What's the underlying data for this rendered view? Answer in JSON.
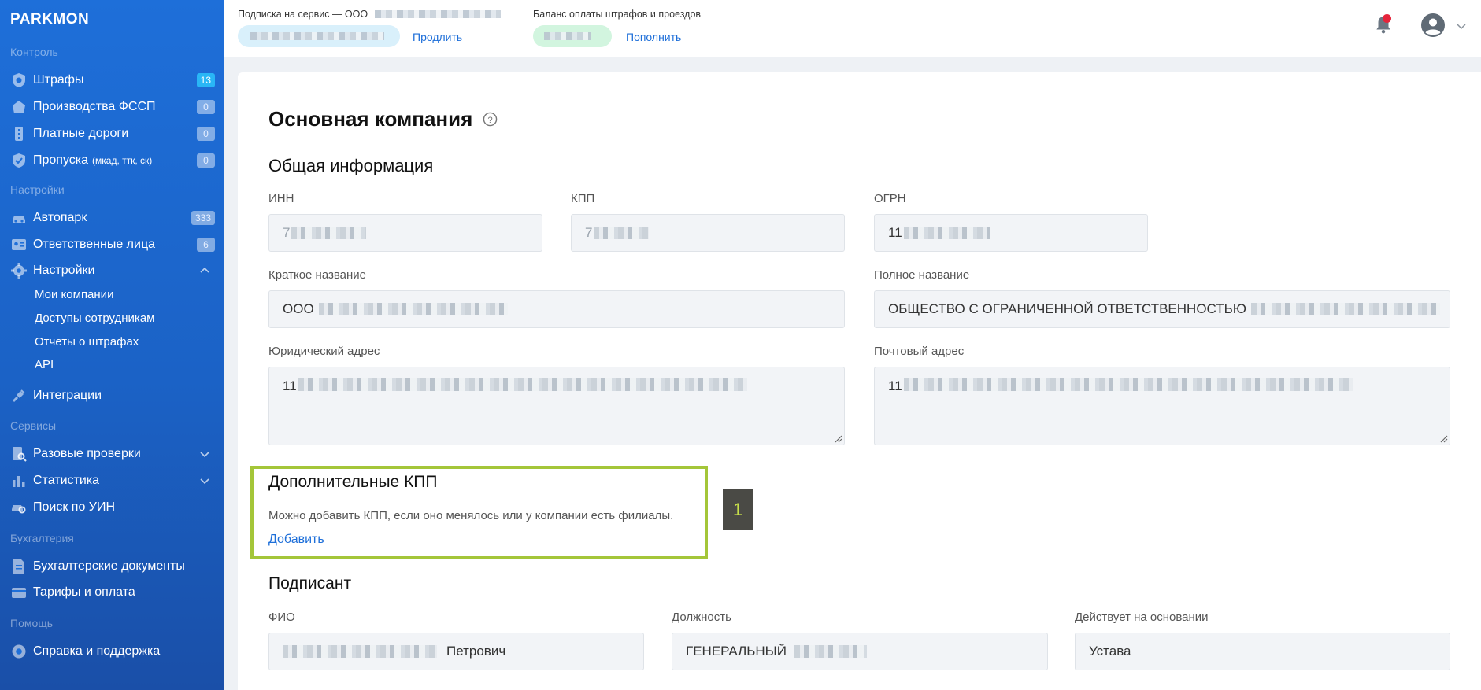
{
  "sidebar": {
    "logo": "PARKMON",
    "sections": {
      "control": "Контроль",
      "settings": "Настройки",
      "services": "Сервисы",
      "accounting": "Бухгалтерия",
      "help": "Помощь"
    },
    "items": {
      "fines": {
        "label": "Штрафы",
        "badge": "13"
      },
      "fssp": {
        "label": "Производства ФССП",
        "badge": "0"
      },
      "toll": {
        "label": "Платные дороги",
        "badge": "0"
      },
      "passes": {
        "label": "Пропуска",
        "sub": "(мкад, ттк, ск)",
        "badge": "0"
      },
      "fleet": {
        "label": "Автопарк",
        "badge": "333"
      },
      "responsible": {
        "label": "Ответственные лица",
        "badge": "6"
      },
      "settings": {
        "label": "Настройки"
      },
      "my_companies": {
        "label": "Мои компании"
      },
      "employee_access": {
        "label": "Доступы сотрудникам"
      },
      "fine_reports": {
        "label": "Отчеты о штрафах"
      },
      "api": {
        "label": "API"
      },
      "integrations": {
        "label": "Интеграции"
      },
      "one_time_checks": {
        "label": "Разовые проверки"
      },
      "statistics": {
        "label": "Статистика"
      },
      "uin_search": {
        "label": "Поиск по УИН"
      },
      "accounting_docs": {
        "label": "Бухгалтерские документы"
      },
      "tariffs": {
        "label": "Тарифы и оплата"
      },
      "support": {
        "label": "Справка и поддержка"
      }
    }
  },
  "topbar": {
    "subscription_label": "Подписка на сервис — ООО",
    "renew_link": "Продлить",
    "balance_label": "Баланс оплаты штрафов и проездов",
    "topup_link": "Пополнить"
  },
  "page": {
    "title": "Основная компания",
    "general_info": "Общая информация",
    "inn_label": "ИНН",
    "inn_value": "7",
    "kpp_label": "КПП",
    "kpp_value": "7",
    "ogrn_label": "ОГРН",
    "ogrn_value": "11",
    "short_name_label": "Краткое название",
    "short_name_value": "ООО",
    "full_name_label": "Полное название",
    "full_name_value": "ОБЩЕСТВО С ОГРАНИЧЕННОЙ ОТВЕТСТВЕННОСТЬЮ",
    "legal_address_label": "Юридический адрес",
    "legal_address_value": "11",
    "postal_address_label": "Почтовый адрес",
    "postal_address_value": "11",
    "extra_kpp_title": "Дополнительные КПП",
    "extra_kpp_hint": "Можно добавить КПП, если оно менялось или у компании есть филиалы.",
    "add_link": "Добавить",
    "marker": "1",
    "signer_title": "Подписант",
    "fio_label": "ФИО",
    "fio_value": "Петрович",
    "position_label": "Должность",
    "position_value": "ГЕНЕРАЛЬНЫЙ",
    "basis_label": "Действует на основании",
    "basis_value": "Устава"
  },
  "colors": {
    "sidebar": "#1e6fd9",
    "accent": "#1e6fd9",
    "highlight": "#a4c639",
    "notification": "#e5243b"
  }
}
